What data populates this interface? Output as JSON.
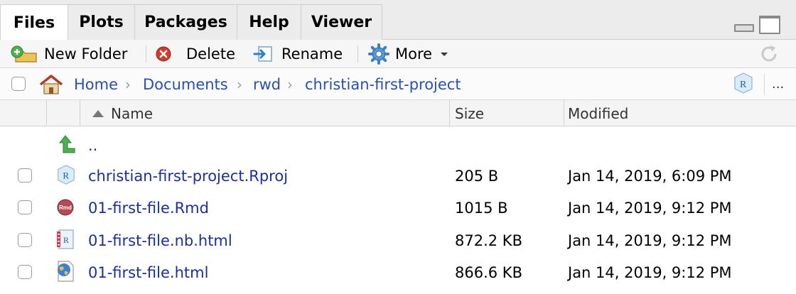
{
  "tabs": [
    {
      "label": "Files"
    },
    {
      "label": "Plots"
    },
    {
      "label": "Packages"
    },
    {
      "label": "Help"
    },
    {
      "label": "Viewer"
    }
  ],
  "toolbar": {
    "new_folder": "New Folder",
    "delete": "Delete",
    "rename": "Rename",
    "more": "More"
  },
  "breadcrumb": {
    "items": [
      "Home",
      "Documents",
      "rwd",
      "christian-first-project"
    ],
    "overflow": "..."
  },
  "columns": {
    "name": "Name",
    "size": "Size",
    "modified": "Modified"
  },
  "parent_link": "..",
  "files": [
    {
      "name": "christian-first-project.Rproj",
      "size": "205 B",
      "modified": "Jan 14, 2019, 6:09 PM",
      "icon": "rproj-icon"
    },
    {
      "name": "01-first-file.Rmd",
      "size": "1015 B",
      "modified": "Jan 14, 2019, 9:12 PM",
      "icon": "rmd-icon"
    },
    {
      "name": "01-first-file.nb.html",
      "size": "872.2 KB",
      "modified": "Jan 14, 2019, 9:12 PM",
      "icon": "notebook-icon"
    },
    {
      "name": "01-first-file.html",
      "size": "866.6 KB",
      "modified": "Jan 14, 2019, 9:12 PM",
      "icon": "html-globe-icon"
    }
  ]
}
